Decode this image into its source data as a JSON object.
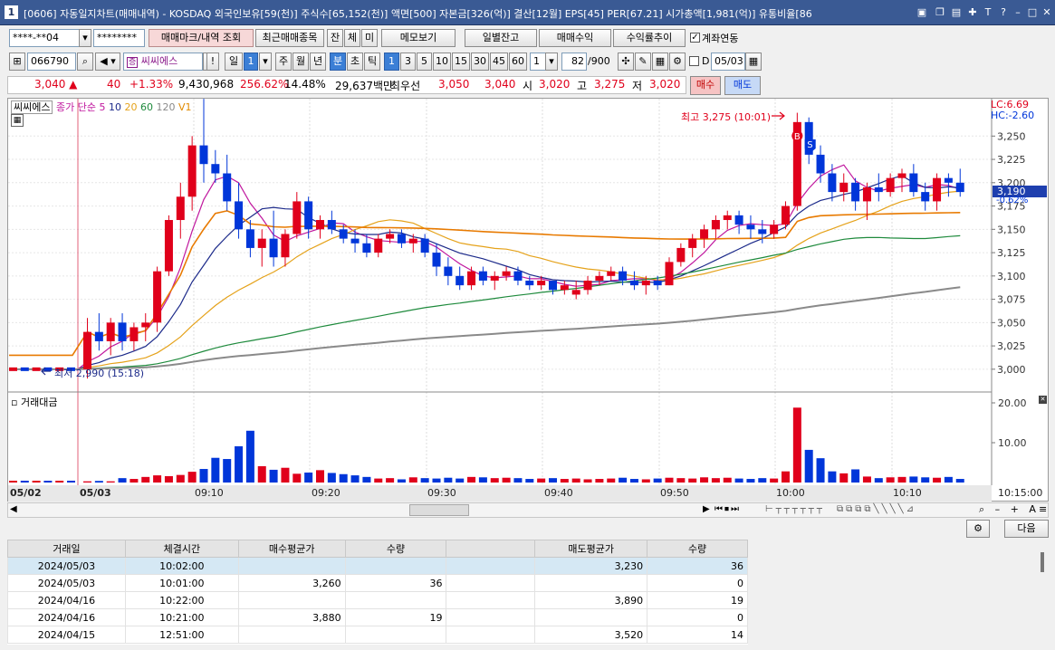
{
  "window": {
    "number": "1",
    "title": "[0606] 자동일지차트(매매내역) - KOSDAQ 외국인보유[59(천)] 주식수[65,152(천)] 액면[500] 자본금[326(억)] 결산[12월] EPS[45] PER[67.21] 시가총액[1,981(억)] 유통비율[86"
  },
  "toolbar1": {
    "account": "****-**04",
    "password": "********",
    "btn_trade_mark": "매매마크/내역 조회",
    "btn_recent": "최근매매종목",
    "btn_jan": "잔",
    "btn_che": "체",
    "btn_mi": "미",
    "btn_memo": "메모보기",
    "btn_daily_balance": "일별잔고",
    "btn_trade_profit": "매매수익",
    "btn_return_trend": "수익률추이",
    "account_link_label": "계좌연동"
  },
  "toolbar2": {
    "code": "066790",
    "stock_name": "씨씨에스",
    "warn": "!",
    "p_il": "일",
    "p_ju": "주",
    "p_wol": "월",
    "p_nyeon": "년",
    "p_bun": "분",
    "p_cho": "초",
    "p_tik": "틱",
    "mins": [
      "1",
      "3",
      "5",
      "10",
      "15",
      "30",
      "45",
      "60"
    ],
    "interval_value": "1",
    "count_value": "82",
    "count_total": "/900",
    "d_label": "D",
    "date_value": "05/03",
    "il_value": "1"
  },
  "quote": {
    "price": "3,040 ▲",
    "change": "40",
    "rate": "+1.33%",
    "volume": "9,430,968",
    "vol_ratio": "256.62%",
    "turnover": "14.48%",
    "amount": "29,637백만",
    "best_bid_label": "최우선",
    "ask": "3,050",
    "bid": "3,040",
    "open_label": "시",
    "open": "3,020",
    "high_label": "고",
    "high": "3,275",
    "low_label": "저",
    "low": "3,020",
    "buy": "매수",
    "sell": "매도"
  },
  "chart_data": {
    "type": "line",
    "title": "씨씨에스",
    "legend": {
      "prefix": "종가 단순",
      "ma": [
        {
          "label": "5",
          "color": "#c0179e"
        },
        {
          "label": "10",
          "color": "#1c2a8a"
        },
        {
          "label": "20",
          "color": "#e5a21a"
        },
        {
          "label": "60",
          "color": "#1e8a3c"
        },
        {
          "label": "120",
          "color": "#8a8a8a"
        }
      ],
      "v1": "V1"
    },
    "x": [
      "09:00",
      "09:01",
      "09:02",
      "09:03",
      "09:04",
      "09:05",
      "09:06",
      "09:07",
      "09:08",
      "09:09",
      "09:10",
      "09:11",
      "09:12",
      "09:13",
      "09:14",
      "09:15",
      "09:16",
      "09:17",
      "09:18",
      "09:19",
      "09:20",
      "09:21",
      "09:22",
      "09:23",
      "09:24",
      "09:25",
      "09:26",
      "09:27",
      "09:28",
      "09:29",
      "09:30",
      "09:31",
      "09:32",
      "09:33",
      "09:34",
      "09:35",
      "09:36",
      "09:37",
      "09:38",
      "09:39",
      "09:40",
      "09:41",
      "09:42",
      "09:43",
      "09:44",
      "09:45",
      "09:46",
      "09:47",
      "09:48",
      "09:49",
      "09:50",
      "09:51",
      "09:52",
      "09:53",
      "09:54",
      "09:55",
      "09:56",
      "09:57",
      "09:58",
      "09:59",
      "10:00",
      "10:01",
      "10:02",
      "10:03",
      "10:04",
      "10:05",
      "10:06",
      "10:07",
      "10:08",
      "10:09",
      "10:10",
      "10:11",
      "10:12",
      "10:13",
      "10:14",
      "10:15"
    ],
    "ohlc": [
      [
        3000,
        3055,
        2990,
        3040
      ],
      [
        3040,
        3060,
        3020,
        3030
      ],
      [
        3030,
        3055,
        3015,
        3050
      ],
      [
        3050,
        3060,
        3020,
        3030
      ],
      [
        3030,
        3050,
        3020,
        3045
      ],
      [
        3045,
        3060,
        3030,
        3050
      ],
      [
        3050,
        3110,
        3040,
        3105
      ],
      [
        3105,
        3165,
        3100,
        3160
      ],
      [
        3160,
        3200,
        3140,
        3185
      ],
      [
        3185,
        3250,
        3170,
        3240
      ],
      [
        3240,
        3290,
        3200,
        3220
      ],
      [
        3220,
        3235,
        3200,
        3210
      ],
      [
        3210,
        3230,
        3170,
        3180
      ],
      [
        3180,
        3200,
        3140,
        3150
      ],
      [
        3150,
        3160,
        3120,
        3130
      ],
      [
        3130,
        3150,
        3110,
        3140
      ],
      [
        3140,
        3170,
        3110,
        3120
      ],
      [
        3120,
        3150,
        3110,
        3145
      ],
      [
        3145,
        3190,
        3140,
        3180
      ],
      [
        3180,
        3185,
        3140,
        3150
      ],
      [
        3150,
        3165,
        3140,
        3160
      ],
      [
        3160,
        3170,
        3145,
        3150
      ],
      [
        3150,
        3155,
        3135,
        3140
      ],
      [
        3140,
        3150,
        3125,
        3135
      ],
      [
        3135,
        3145,
        3120,
        3125
      ],
      [
        3125,
        3145,
        3120,
        3140
      ],
      [
        3140,
        3150,
        3135,
        3145
      ],
      [
        3145,
        3150,
        3130,
        3135
      ],
      [
        3135,
        3145,
        3125,
        3140
      ],
      [
        3140,
        3145,
        3120,
        3125
      ],
      [
        3125,
        3135,
        3100,
        3110
      ],
      [
        3110,
        3120,
        3090,
        3100
      ],
      [
        3100,
        3110,
        3085,
        3090
      ],
      [
        3090,
        3110,
        3085,
        3105
      ],
      [
        3105,
        3110,
        3090,
        3095
      ],
      [
        3095,
        3105,
        3085,
        3100
      ],
      [
        3100,
        3110,
        3095,
        3105
      ],
      [
        3105,
        3110,
        3090,
        3095
      ],
      [
        3095,
        3100,
        3085,
        3090
      ],
      [
        3090,
        3100,
        3085,
        3095
      ],
      [
        3095,
        3095,
        3080,
        3085
      ],
      [
        3085,
        3095,
        3080,
        3090
      ],
      [
        3080,
        3095,
        3075,
        3085
      ],
      [
        3085,
        3100,
        3080,
        3095
      ],
      [
        3095,
        3105,
        3090,
        3100
      ],
      [
        3100,
        3110,
        3095,
        3105
      ],
      [
        3105,
        3110,
        3090,
        3095
      ],
      [
        3095,
        3105,
        3085,
        3090
      ],
      [
        3090,
        3100,
        3080,
        3095
      ],
      [
        3095,
        3100,
        3085,
        3090
      ],
      [
        3090,
        3120,
        3090,
        3115
      ],
      [
        3115,
        3135,
        3110,
        3130
      ],
      [
        3130,
        3145,
        3120,
        3140
      ],
      [
        3140,
        3155,
        3130,
        3150
      ],
      [
        3150,
        3165,
        3140,
        3160
      ],
      [
        3160,
        3170,
        3150,
        3165
      ],
      [
        3165,
        3170,
        3145,
        3155
      ],
      [
        3155,
        3165,
        3140,
        3150
      ],
      [
        3150,
        3160,
        3135,
        3145
      ],
      [
        3145,
        3160,
        3140,
        3155
      ],
      [
        3155,
        3180,
        3150,
        3175
      ],
      [
        3175,
        3275,
        3170,
        3265
      ],
      [
        3265,
        3270,
        3220,
        3230
      ],
      [
        3230,
        3240,
        3200,
        3210
      ],
      [
        3210,
        3220,
        3180,
        3190
      ],
      [
        3190,
        3210,
        3180,
        3200
      ],
      [
        3200,
        3205,
        3170,
        3180
      ],
      [
        3180,
        3200,
        3160,
        3195
      ],
      [
        3195,
        3210,
        3180,
        3190
      ],
      [
        3190,
        3210,
        3185,
        3205
      ],
      [
        3205,
        3215,
        3190,
        3210
      ],
      [
        3210,
        3220,
        3185,
        3190
      ],
      [
        3190,
        3200,
        3170,
        3180
      ],
      [
        3180,
        3210,
        3170,
        3205
      ],
      [
        3205,
        3210,
        3185,
        3200
      ],
      [
        3200,
        3215,
        3185,
        3190
      ]
    ],
    "amount": [
      0.3,
      0.4,
      0.3,
      1.1,
      0.9,
      1.4,
      1.8,
      1.6,
      1.9,
      2.7,
      3.4,
      6.2,
      5.9,
      9.1,
      13.0,
      4.1,
      3.2,
      3.7,
      2.2,
      2.5,
      3.1,
      2.4,
      2.1,
      1.8,
      1.4,
      1.0,
      1.1,
      0.8,
      1.3,
      1.1,
      1.0,
      1.2,
      1.0,
      1.4,
      1.3,
      1.1,
      1.2,
      1.1,
      0.9,
      1.0,
      1.1,
      0.9,
      1.0,
      0.8,
      0.9,
      1.0,
      1.2,
      0.9,
      0.8,
      1.0,
      1.2,
      1.1,
      1.0,
      1.3,
      1.1,
      1.2,
      1.0,
      0.9,
      1.1,
      1.0,
      2.8,
      18.8,
      8.2,
      6.1,
      2.8,
      2.3,
      3.3,
      1.5,
      1.1,
      1.3,
      1.4,
      1.5,
      1.3,
      1.2,
      1.4,
      0.9
    ],
    "ylim": [
      2980,
      3300
    ],
    "yticks": [
      "3,250",
      "3,225",
      "3,200",
      "3,175",
      "3,150",
      "3,125",
      "3,100",
      "3,075",
      "3,050",
      "3,025",
      "3,000"
    ],
    "amount_label": "거래대금",
    "amount_ticks": [
      "20.00",
      "10.00"
    ],
    "xticks": [
      "05/02",
      "05/03",
      "09:10",
      "09:20",
      "09:30",
      "09:40",
      "09:50",
      "10:00",
      "10:10",
      "10:15:00"
    ],
    "high_annotation": "최고 3,275 (10:01)",
    "low_annotation": "최저 2,990 (15:18)",
    "lc": "LC:6.69",
    "hc": "HC:-2.60",
    "current_price": "3,190",
    "current_rate": "-0.62%",
    "buy_marker": "B",
    "sell_marker": "S"
  },
  "bottom_bar": {
    "settings_icon": "gear-icon",
    "next": "다음"
  },
  "trades": {
    "headers": [
      "거래일",
      "체결시간",
      "매수평균가",
      "수량",
      "",
      "매도평균가",
      "수량"
    ],
    "rows": [
      [
        "2024/05/03",
        "10:02:00",
        "",
        "",
        "",
        "3,230",
        "36"
      ],
      [
        "2024/05/03",
        "10:01:00",
        "3,260",
        "36",
        "",
        "",
        "0"
      ],
      [
        "2024/04/16",
        "10:22:00",
        "",
        "",
        "",
        "3,890",
        "19"
      ],
      [
        "2024/04/16",
        "10:21:00",
        "3,880",
        "19",
        "",
        "",
        "0"
      ],
      [
        "2024/04/15",
        "12:51:00",
        "",
        "",
        "",
        "3,520",
        "14"
      ]
    ]
  }
}
